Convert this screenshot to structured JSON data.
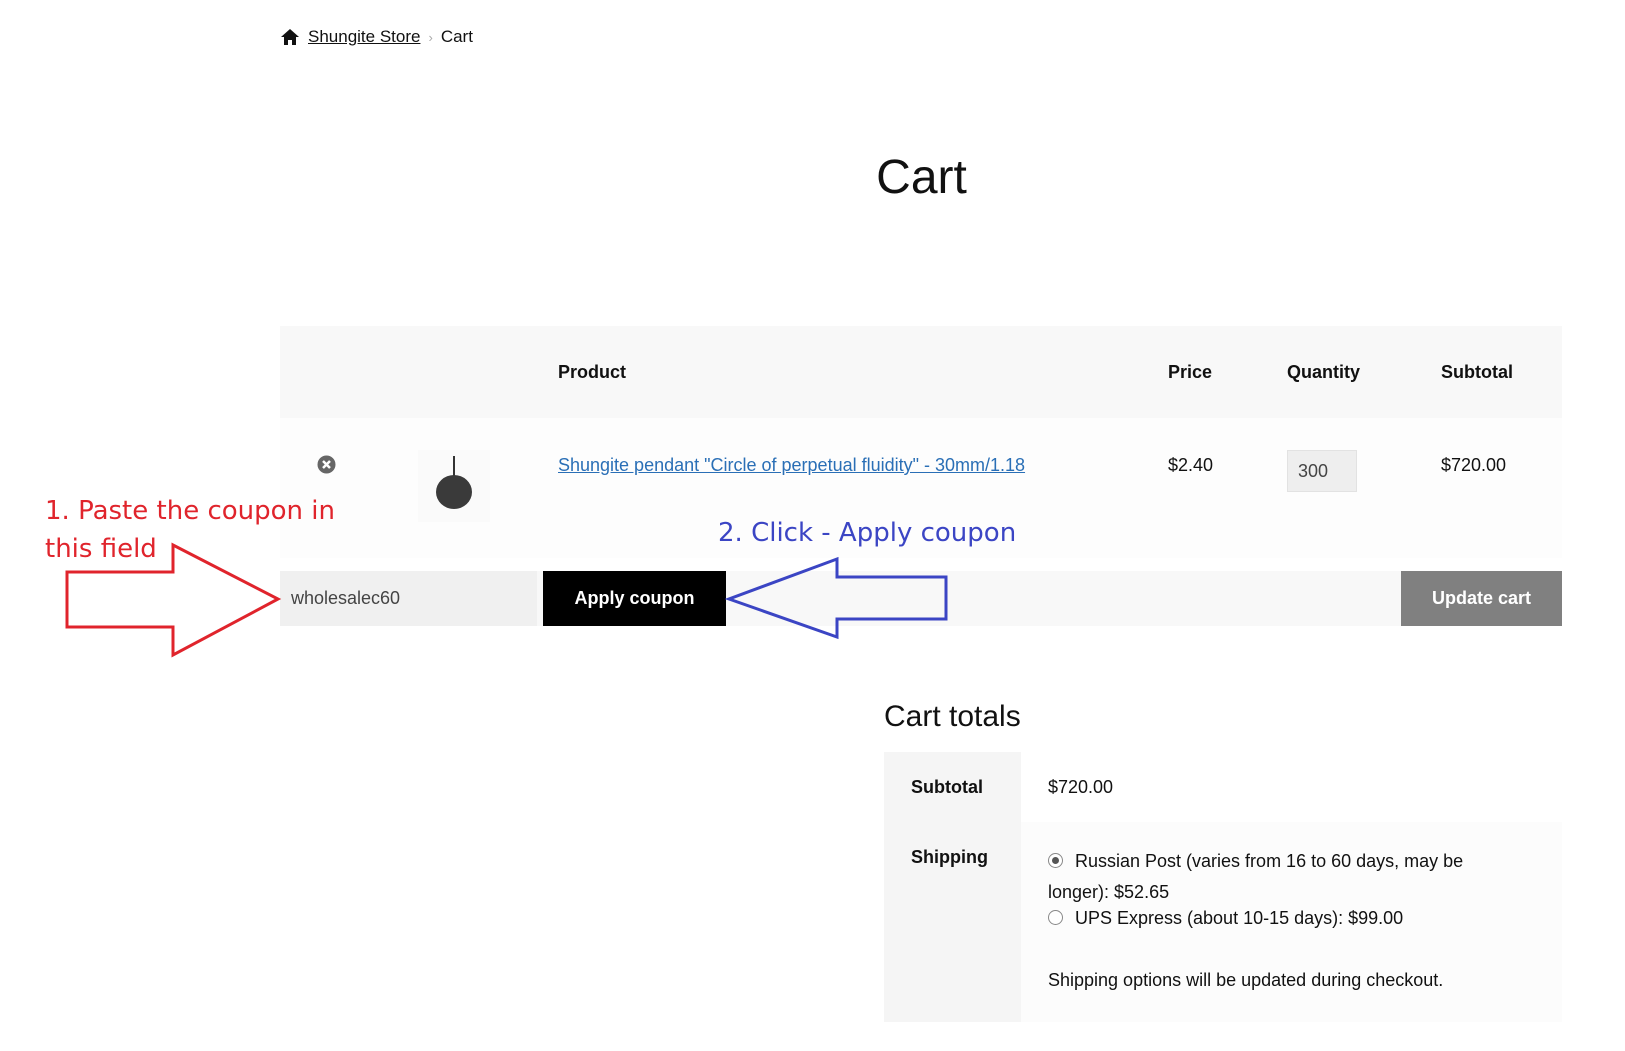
{
  "breadcrumb": {
    "home": "Shungite Store",
    "current": "Cart",
    "separator": "›"
  },
  "page_title": "Cart",
  "table": {
    "headers": [
      "Product",
      "Price",
      "Quantity",
      "Subtotal"
    ],
    "rows": [
      {
        "product": "Shungite pendant \"Circle of perpetual fluidity\" - 30mm/1.18",
        "price": "$2.40",
        "quantity": "300",
        "subtotal": "$720.00"
      }
    ]
  },
  "coupon": {
    "value": "wholesalec60",
    "apply_label": "Apply coupon"
  },
  "update_label": "Update cart",
  "totals": {
    "title": "Cart totals",
    "subtotal_label": "Subtotal",
    "subtotal": "$720.00",
    "shipping_label": "Shipping",
    "options": [
      {
        "label": "Russian Post (varies from 16 to 60 days, may be longer): $52.65",
        "selected": true
      },
      {
        "label": "UPS Express (about 10-15 days): $99.00",
        "selected": false
      }
    ],
    "shipping_note": "Shipping options will be updated during checkout."
  },
  "annotations": {
    "step1": "1. Paste the coupon in this field",
    "step2": "2. Click - Apply coupon",
    "step1_color": "#e0242c",
    "step2_color": "#3b45c4"
  }
}
